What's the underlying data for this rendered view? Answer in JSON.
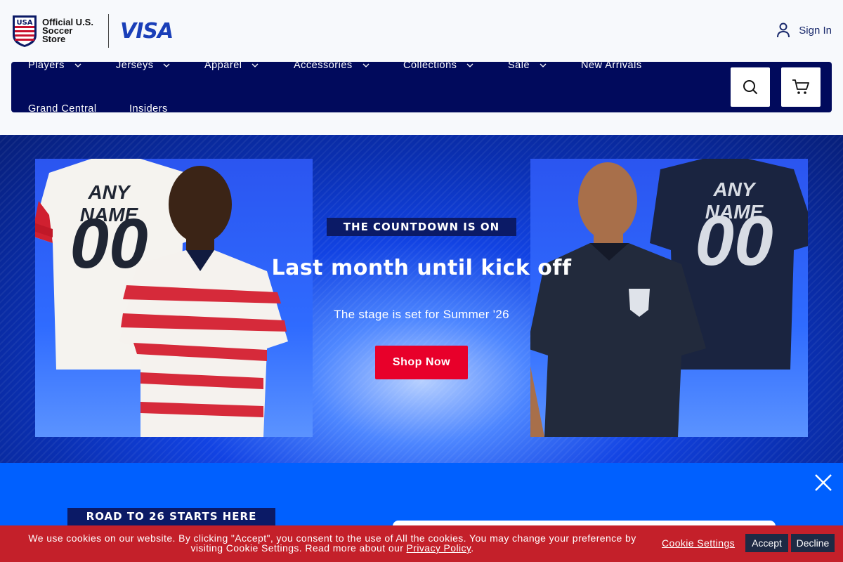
{
  "header": {
    "store_name": "Official U.S. Soccer Store",
    "crest_text": "USA",
    "partner_logo": "VISA",
    "signin_label": "Sign In",
    "signin_icon": "user-icon"
  },
  "nav": {
    "items": [
      {
        "label": "Players",
        "has_dropdown": true
      },
      {
        "label": "Jerseys",
        "has_dropdown": true
      },
      {
        "label": "Apparel",
        "has_dropdown": true
      },
      {
        "label": "Accessories",
        "has_dropdown": true
      },
      {
        "label": "Collections",
        "has_dropdown": true
      },
      {
        "label": "Sale",
        "has_dropdown": true
      },
      {
        "label": "New Arrivals",
        "has_dropdown": false
      },
      {
        "label": "Grand Central",
        "has_dropdown": false
      },
      {
        "label": "Insiders",
        "has_dropdown": false
      }
    ],
    "search_icon": "search-icon",
    "cart_icon": "cart-icon"
  },
  "hero": {
    "kicker": "THE COUNTDOWN IS ON",
    "title": "Last month until kick off",
    "subtitle": "The stage is set for Summer '26",
    "cta_label": "Shop Now",
    "left_jersey": {
      "name": "ANY NAME",
      "number": "00"
    },
    "right_jersey": {
      "name": "ANY NAME",
      "number": "00"
    }
  },
  "promo": {
    "badge": "ROAD TO 26 STARTS HERE",
    "close_icon": "close-icon"
  },
  "cookie": {
    "text_line1": "We use cookies on our website. By clicking \"Accept\", you consent to the use of All the cookies. You may change your preference by",
    "text_line2_prefix": "visiting Cookie Settings. Read more about our ",
    "privacy_link": "Privacy Policy",
    "text_line2_suffix": ".",
    "settings_label": "Cookie Settings",
    "accept_label": "Accept",
    "decline_label": "Decline"
  },
  "colors": {
    "nav_bg": "#010a5c",
    "cta_red": "#e8002a",
    "promo_blue": "#0060ff",
    "cookie_red": "#c4202a",
    "visa_blue": "#1a3fb8"
  }
}
